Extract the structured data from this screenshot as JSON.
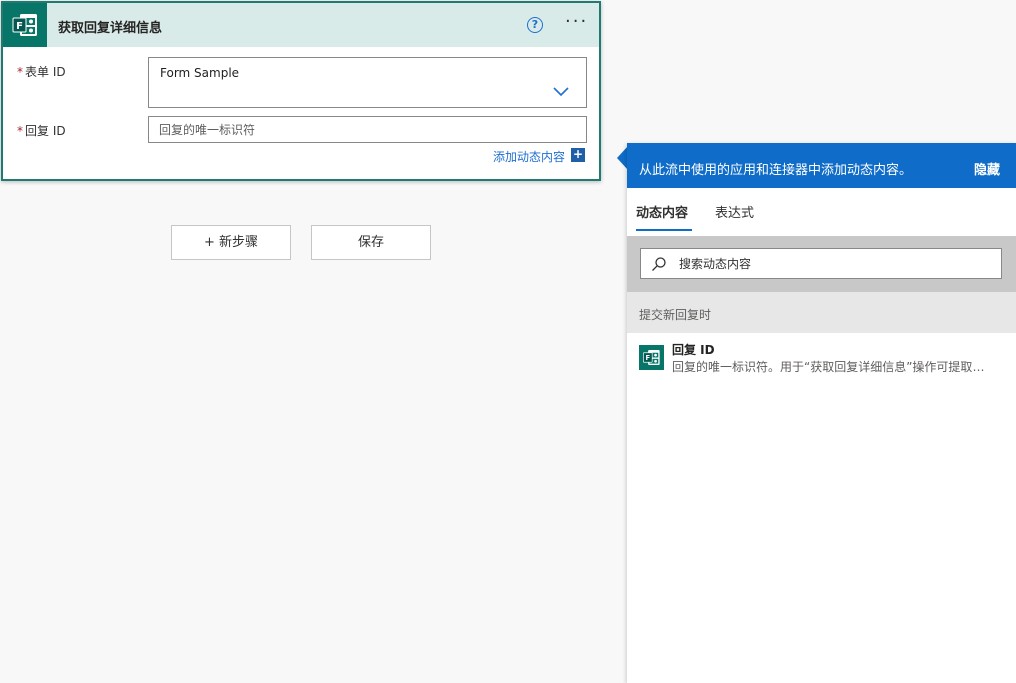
{
  "card": {
    "title": "获取回复详细信息",
    "help_symbol": "?",
    "more_symbol": "···",
    "fields": {
      "form_id": {
        "required_mark": "*",
        "label": "表单 ID",
        "value": "Form Sample"
      },
      "response_id": {
        "required_mark": "*",
        "label": "回复 ID",
        "placeholder": "回复的唯一标识符"
      }
    },
    "add_dynamic_label": "添加动态内容",
    "add_dynamic_symbol": "+"
  },
  "buttons": {
    "new_step": "+ 新步骤",
    "save": "保存"
  },
  "panel": {
    "header_text": "从此流中使用的应用和连接器中添加动态内容。",
    "hide_label": "隐藏",
    "tabs": [
      {
        "label": "动态内容",
        "active": true
      },
      {
        "label": "表达式",
        "active": false
      }
    ],
    "search_placeholder": "搜索动态内容",
    "section_title": "提交新回复时",
    "items": [
      {
        "title": "回复 ID",
        "description": "回复的唯一标识符。用于“获取回复详细信息”操作可提取表…",
        "icon": "forms-icon"
      }
    ]
  },
  "colors": {
    "accent": "#0f6cc8",
    "forms_brand": "#077568",
    "card_header_bg": "#d9ebe9",
    "required": "#a4262c"
  }
}
